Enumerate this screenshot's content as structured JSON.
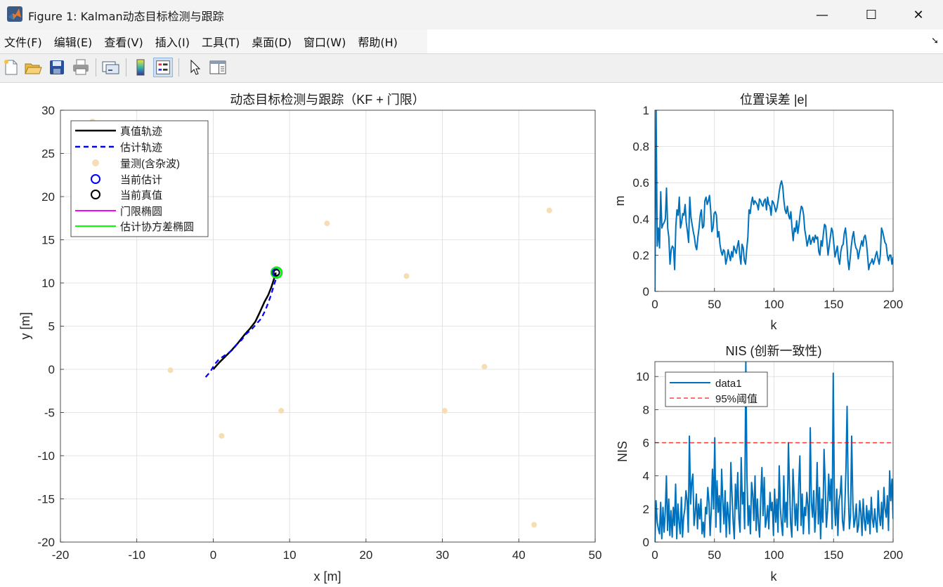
{
  "window": {
    "title": "Figure 1: Kalman动态目标检测与跟踪",
    "icon": "matlab-logo-icon",
    "controls": {
      "minimize": "—",
      "maximize": "☐",
      "close": "✕"
    }
  },
  "menu": [
    "文件(F)",
    "编辑(E)",
    "查看(V)",
    "插入(I)",
    "工具(T)",
    "桌面(D)",
    "窗口(W)",
    "帮助(H)"
  ],
  "toolbar": [
    "new-figure-icon",
    "open-file-icon",
    "save-icon",
    "print-icon",
    "link-plot-icon",
    "insert-colorbar-icon",
    "insert-legend-icon",
    "edit-plot-icon",
    "property-inspector-icon"
  ],
  "colors": {
    "truth": "#000000",
    "estimate": "#0000ff",
    "measurement": "#f5deb3",
    "gate": "#ff00ff",
    "covariance": "#00ff00",
    "matlab_blue": "#0072bd",
    "threshold": "#ff0000"
  },
  "chart_data": [
    {
      "type": "line",
      "title": "动态目标检测与跟踪（KF + 门限）",
      "xlabel": "x [m]",
      "ylabel": "y [m]",
      "xlim": [
        -20,
        50
      ],
      "ylim": [
        -20,
        30
      ],
      "xticks": [
        -20,
        -10,
        0,
        10,
        20,
        30,
        40,
        50
      ],
      "yticks": [
        -20,
        -15,
        -10,
        -5,
        0,
        5,
        10,
        15,
        20,
        25,
        30
      ],
      "grid": true,
      "legend_position": "top-left",
      "series": [
        {
          "name": "真值轨迹",
          "kind": "line",
          "x": [
            0,
            0.8,
            1.6,
            2.4,
            3.2,
            4.0,
            4.8,
            5.5,
            6.1,
            6.7,
            7.2,
            7.6,
            7.9,
            8.2
          ],
          "y": [
            0,
            0.8,
            1.5,
            2.2,
            3.0,
            3.9,
            4.7,
            5.5,
            6.6,
            7.8,
            8.6,
            9.5,
            10.3,
            11.2
          ]
        },
        {
          "name": "估计轨迹",
          "kind": "dashed",
          "x": [
            -1.0,
            -0.4,
            0.2,
            0.7,
            1.3,
            2.0,
            2.6,
            3.1,
            3.7,
            4.3,
            5.0,
            5.6,
            6.3,
            6.8,
            7.2,
            7.6,
            7.9,
            8.3
          ],
          "y": [
            -0.9,
            -0.3,
            0.6,
            1.1,
            1.5,
            1.9,
            2.3,
            2.9,
            3.4,
            4.1,
            4.6,
            5.2,
            5.9,
            6.8,
            7.7,
            8.7,
            9.6,
            10.7
          ]
        },
        {
          "name": "量测(含杂波)",
          "kind": "markers",
          "x": [
            -15.8,
            -5.6,
            1.1,
            8.9,
            14.9,
            25.3,
            30.3,
            35.5,
            42.0,
            44.0
          ],
          "y": [
            28.7,
            -0.1,
            -7.7,
            -4.8,
            16.9,
            10.8,
            -4.8,
            0.3,
            -18.0,
            18.4
          ]
        },
        {
          "name": "当前估计",
          "kind": "circle",
          "x": [
            8.2
          ],
          "y": [
            11.2
          ]
        },
        {
          "name": "当前真值",
          "kind": "circle",
          "x": [
            8.3
          ],
          "y": [
            11.2
          ]
        },
        {
          "name": "门限椭圆",
          "kind": "ellipse",
          "x": [
            8.3
          ],
          "y": [
            11.2
          ]
        },
        {
          "name": "估计协方差椭圆",
          "kind": "ellipse",
          "x": [
            8.3
          ],
          "y": [
            11.2
          ]
        }
      ]
    },
    {
      "type": "line",
      "title": "位置误差 |e|",
      "xlabel": "k",
      "ylabel": "m",
      "xlim": [
        0,
        200
      ],
      "ylim": [
        0,
        1
      ],
      "xticks": [
        0,
        50,
        100,
        150,
        200
      ],
      "yticks": [
        0,
        0.2,
        0.4,
        0.6,
        0.8,
        1
      ],
      "grid": true,
      "series": [
        {
          "values": [
            0.0,
            1.0,
            0.25,
            0.35,
            0.24,
            0.55,
            0.35,
            0.37,
            0.38,
            0.4,
            0.57,
            0.35,
            0.3,
            0.15,
            0.23,
            0.25,
            0.24,
            0.12,
            0.36,
            0.45,
            0.42,
            0.52,
            0.35,
            0.38,
            0.43,
            0.42,
            0.48,
            0.38,
            0.33,
            0.27,
            0.52,
            0.41,
            0.37,
            0.33,
            0.3,
            0.25,
            0.23,
            0.3,
            0.35,
            0.42,
            0.45,
            0.35,
            0.36,
            0.5,
            0.52,
            0.48,
            0.5,
            0.53,
            0.45,
            0.33,
            0.35,
            0.43,
            0.44,
            0.42,
            0.3,
            0.33,
            0.26,
            0.22,
            0.2,
            0.23,
            0.22,
            0.15,
            0.18,
            0.23,
            0.2,
            0.17,
            0.22,
            0.19,
            0.25,
            0.23,
            0.21,
            0.25,
            0.28,
            0.2,
            0.15,
            0.26,
            0.24,
            0.17,
            0.15,
            0.23,
            0.3,
            0.45,
            0.43,
            0.49,
            0.52,
            0.48,
            0.5,
            0.49,
            0.48,
            0.45,
            0.51,
            0.5,
            0.48,
            0.47,
            0.5,
            0.51,
            0.45,
            0.52,
            0.48,
            0.47,
            0.42,
            0.5,
            0.49,
            0.47,
            0.44,
            0.46,
            0.5,
            0.55,
            0.59,
            0.61,
            0.58,
            0.5,
            0.45,
            0.43,
            0.47,
            0.42,
            0.4,
            0.44,
            0.35,
            0.28,
            0.35,
            0.33,
            0.39,
            0.32,
            0.37,
            0.43,
            0.47,
            0.46,
            0.42,
            0.34,
            0.3,
            0.25,
            0.28,
            0.31,
            0.26,
            0.28,
            0.3,
            0.27,
            0.31,
            0.29,
            0.3,
            0.22,
            0.2,
            0.28,
            0.25,
            0.32,
            0.37,
            0.36,
            0.28,
            0.2,
            0.25,
            0.3,
            0.35,
            0.33,
            0.26,
            0.19,
            0.22,
            0.25,
            0.18,
            0.15,
            0.22,
            0.25,
            0.26,
            0.32,
            0.35,
            0.28,
            0.18,
            0.12,
            0.18,
            0.25,
            0.3,
            0.33,
            0.27,
            0.24,
            0.23,
            0.18,
            0.22,
            0.25,
            0.28,
            0.25,
            0.3,
            0.31,
            0.27,
            0.2,
            0.12,
            0.15,
            0.16,
            0.18,
            0.15,
            0.17,
            0.2,
            0.22,
            0.18,
            0.15,
            0.2,
            0.35,
            0.33,
            0.3,
            0.27,
            0.26,
            0.2,
            0.17,
            0.2,
            0.2,
            0.15,
            0.19
          ]
        }
      ]
    },
    {
      "type": "line",
      "title": "NIS (创新一致性)",
      "xlabel": "k",
      "ylabel": "NIS",
      "xlim": [
        0,
        200
      ],
      "ylim": [
        0,
        10.9
      ],
      "xticks": [
        0,
        50,
        100,
        150,
        200
      ],
      "yticks": [
        0,
        2,
        4,
        6,
        8,
        10
      ],
      "grid": true,
      "legend_position": "top-left",
      "series": [
        {
          "name": "data1",
          "values": [
            0.0,
            2.5,
            1.2,
            0.8,
            0.5,
            2.4,
            0.2,
            2.1,
            0.6,
            1.8,
            4.0,
            0.7,
            2.6,
            0.4,
            1.9,
            0.3,
            2.1,
            1.0,
            3.5,
            0.2,
            2.3,
            1.2,
            0.5,
            2.7,
            0.3,
            1.5,
            2.0,
            3.1,
            2.5,
            0.6,
            6.4,
            2.3,
            3.6,
            4.1,
            1.0,
            1.7,
            2.9,
            0.8,
            2.3,
            1.4,
            2.6,
            0.5,
            1.2,
            0.3,
            2.1,
            1.7,
            3.3,
            2.4,
            0.4,
            1.9,
            4.4,
            2.0,
            6.3,
            0.9,
            3.7,
            1.8,
            2.8,
            0.6,
            4.4,
            2.5,
            1.1,
            3.1,
            0.3,
            2.4,
            1.6,
            0.5,
            4.8,
            2.9,
            1.2,
            0.2,
            3.5,
            2.0,
            4.2,
            1.4,
            0.6,
            5.1,
            2.3,
            3.0,
            0.8,
            10.9,
            3.9,
            1.0,
            2.2,
            0.5,
            3.6,
            2.9,
            1.3,
            4.0,
            0.7,
            2.6,
            1.1,
            0.3,
            2.8,
            4.5,
            1.6,
            3.9,
            0.9,
            1.4,
            2.2,
            0.8,
            3.0,
            1.9,
            2.4,
            0.4,
            3.2,
            1.2,
            2.6,
            0.6,
            4.6,
            2.1,
            1.1,
            0.4,
            4.0,
            1.2,
            2.4,
            0.9,
            6.0,
            3.3,
            1.1,
            0.3,
            4.4,
            2.7,
            1.0,
            2.3,
            0.7,
            3.5,
            5.2,
            1.0,
            2.9,
            0.5,
            2.1,
            1.6,
            3.0,
            2.2,
            0.5,
            6.9,
            2.4,
            1.5,
            3.1,
            0.6,
            2.0,
            4.8,
            1.1,
            3.3,
            0.2,
            2.6,
            1.2,
            5.6,
            3.5,
            0.9,
            1.9,
            4.1,
            2.5,
            3.8,
            0.8,
            10.2,
            2.2,
            1.0,
            3.2,
            0.4,
            2.5,
            2.9,
            4.0,
            1.3,
            0.7,
            2.0,
            4.4,
            8.2,
            3.1,
            0.8,
            1.6,
            6.4,
            2.4,
            0.9,
            1.4,
            2.3,
            0.6,
            1.0,
            2.5,
            1.8,
            0.4,
            2.6,
            1.3,
            0.7,
            2.2,
            1.1,
            1.9,
            0.5,
            2.7,
            1.4,
            0.9,
            2.0,
            1.2,
            0.6,
            3.1,
            1.6,
            1.0,
            2.4,
            0.8,
            3.3,
            2.0,
            1.5,
            2.8,
            0.7,
            4.3,
            2.5,
            3.8,
            1.4
          ]
        },
        {
          "name": "95%阈值",
          "constant": 6
        }
      ]
    }
  ]
}
